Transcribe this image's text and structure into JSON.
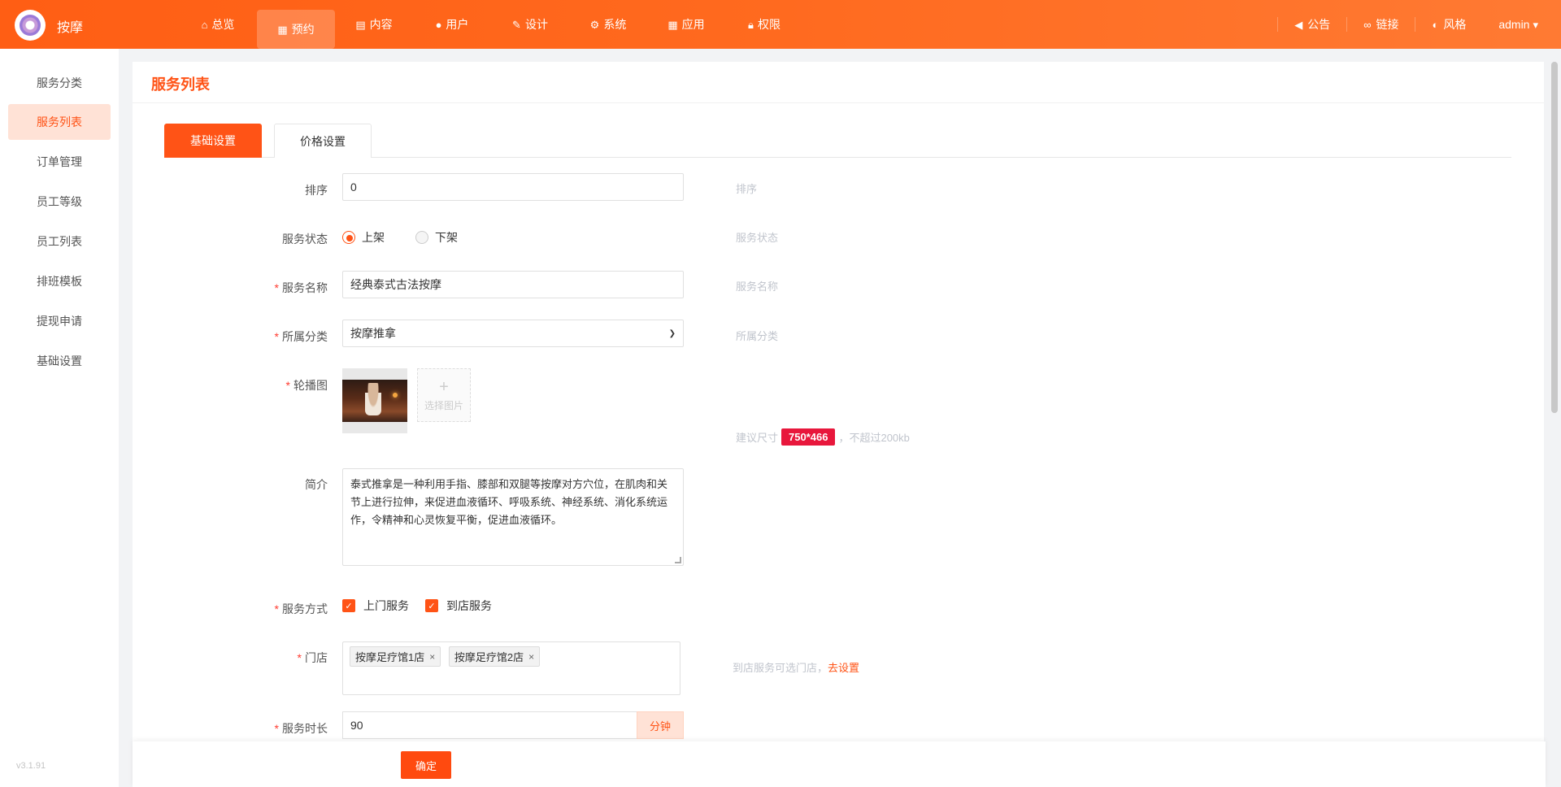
{
  "app": {
    "brand": "按摩"
  },
  "topnav": [
    {
      "label": "总览",
      "icon": "home-icon"
    },
    {
      "label": "预约",
      "icon": "calendar-icon"
    },
    {
      "label": "内容",
      "icon": "document-icon"
    },
    {
      "label": "用户",
      "icon": "user-icon"
    },
    {
      "label": "设计",
      "icon": "brush-icon"
    },
    {
      "label": "系统",
      "icon": "gear-icon"
    },
    {
      "label": "应用",
      "icon": "grid-icon"
    },
    {
      "label": "权限",
      "icon": "lock-icon"
    }
  ],
  "topright": [
    {
      "label": "公告",
      "icon": "speaker-icon"
    },
    {
      "label": "链接",
      "icon": "link-icon"
    },
    {
      "label": "风格",
      "icon": "palette-icon"
    }
  ],
  "user": {
    "name": "admin"
  },
  "sidebar": {
    "items": [
      {
        "label": "服务分类"
      },
      {
        "label": "服务列表"
      },
      {
        "label": "订单管理"
      },
      {
        "label": "员工等级"
      },
      {
        "label": "员工列表"
      },
      {
        "label": "排班模板"
      },
      {
        "label": "提现申请"
      },
      {
        "label": "基础设置"
      }
    ],
    "active": "服务列表",
    "version": "v3.1.91"
  },
  "page": {
    "title": "服务列表"
  },
  "tabs": [
    {
      "label": "基础设置"
    },
    {
      "label": "价格设置"
    }
  ],
  "form": {
    "sort": {
      "label": "排序",
      "value": "0",
      "hint": "排序"
    },
    "status": {
      "label": "服务状态",
      "options": [
        "上架",
        "下架"
      ],
      "selected": "上架",
      "hint": "服务状态"
    },
    "name": {
      "label": "服务名称",
      "value": "经典泰式古法按摩",
      "hint": "服务名称"
    },
    "category": {
      "label": "所属分类",
      "value": "按摩推拿",
      "hint": "所属分类"
    },
    "carousel": {
      "label": "轮播图",
      "upload_text": "选择图片",
      "hint_prefix": "建议尺寸",
      "size_tag": "750*466",
      "hint_suffix": "，不超过200kb"
    },
    "intro": {
      "label": "简介",
      "value": "泰式推拿是一种利用手指、膝部和双腿等按摩对方穴位，在肌肉和关节上进行拉伸，来促进血液循环、呼吸系统、神经系统、消化系统运作，令精神和心灵恢复平衡，促进血液循环。"
    },
    "mode": {
      "label": "服务方式",
      "options": [
        "上门服务",
        "到店服务"
      ]
    },
    "stores": {
      "label": "门店",
      "chips": [
        "按摩足疗馆1店",
        "按摩足疗馆2店"
      ],
      "hint": "到店服务可选门店，",
      "hint_link": "去设置"
    },
    "duration": {
      "label": "服务时长",
      "value": "90",
      "unit": "分钟"
    }
  },
  "footer": {
    "confirm": "确定"
  },
  "colors": {
    "primary": "#ff5316",
    "accent_red": "#e8173c"
  }
}
